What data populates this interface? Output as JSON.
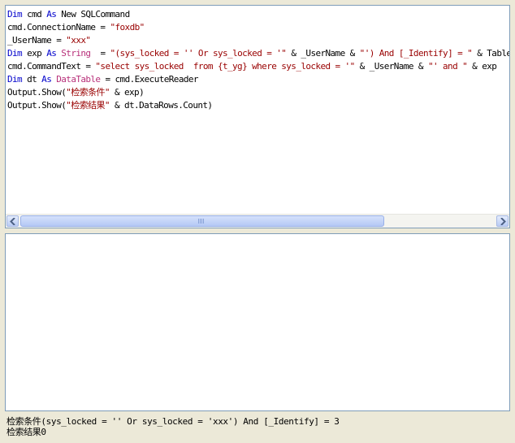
{
  "editor": {
    "lines": [
      [
        {
          "t": "Dim",
          "c": "kw"
        },
        {
          "t": " cmd ",
          "c": "id"
        },
        {
          "t": "As",
          "c": "kw"
        },
        {
          "t": " New SQLCommand",
          "c": "id"
        }
      ],
      [
        {
          "t": "cmd.ConnectionName = ",
          "c": "id"
        },
        {
          "t": "\"foxdb\"",
          "c": "str"
        }
      ],
      [
        {
          "t": "_UserName = ",
          "c": "id"
        },
        {
          "t": "\"xxx\"",
          "c": "str"
        }
      ],
      [
        {
          "t": "Dim",
          "c": "kw"
        },
        {
          "t": " exp ",
          "c": "id"
        },
        {
          "t": "As",
          "c": "kw"
        },
        {
          "t": " ",
          "c": "id"
        },
        {
          "t": "String",
          "c": "type"
        },
        {
          "t": "  = ",
          "c": "id"
        },
        {
          "t": "\"(sys_locked = '' Or sys_locked = '\"",
          "c": "str"
        },
        {
          "t": " & _UserName & ",
          "c": "id"
        },
        {
          "t": "\"') And [_Identify] = \"",
          "c": "str"
        },
        {
          "t": " & Tables(",
          "c": "id"
        }
      ],
      [
        {
          "t": "cmd.CommandText = ",
          "c": "id"
        },
        {
          "t": "\"select sys_locked  from {t_yg} where sys_locked = '\"",
          "c": "str"
        },
        {
          "t": " & _UserName & ",
          "c": "id"
        },
        {
          "t": "\"' and \"",
          "c": "str"
        },
        {
          "t": " & exp",
          "c": "id"
        }
      ],
      [
        {
          "t": "Dim",
          "c": "kw"
        },
        {
          "t": " dt ",
          "c": "id"
        },
        {
          "t": "As",
          "c": "kw"
        },
        {
          "t": " ",
          "c": "id"
        },
        {
          "t": "DataTable",
          "c": "type"
        },
        {
          "t": " = cmd.ExecuteReader",
          "c": "id"
        }
      ],
      [
        {
          "t": "Output.Show(",
          "c": "id"
        },
        {
          "t": "\"检索条件\"",
          "c": "str"
        },
        {
          "t": " & exp)",
          "c": "id"
        }
      ],
      [
        {
          "t": "Output.Show(",
          "c": "id"
        },
        {
          "t": "\"检索结果\"",
          "c": "str"
        },
        {
          "t": " & dt.DataRows.Count)",
          "c": "id"
        }
      ]
    ]
  },
  "scrollbar": {
    "left_icon": "arrow-left-icon",
    "right_icon": "arrow-right-icon"
  },
  "colors": {
    "keyword": "#0000cc",
    "string": "#990000",
    "type": "#b8307a",
    "border": "#7f9db9",
    "window_bg": "#ece9d8"
  },
  "output": {
    "line1": "检索条件(sys_locked = '' Or sys_locked = 'xxx') And [_Identify] = 3",
    "line2": "检索结果0"
  }
}
